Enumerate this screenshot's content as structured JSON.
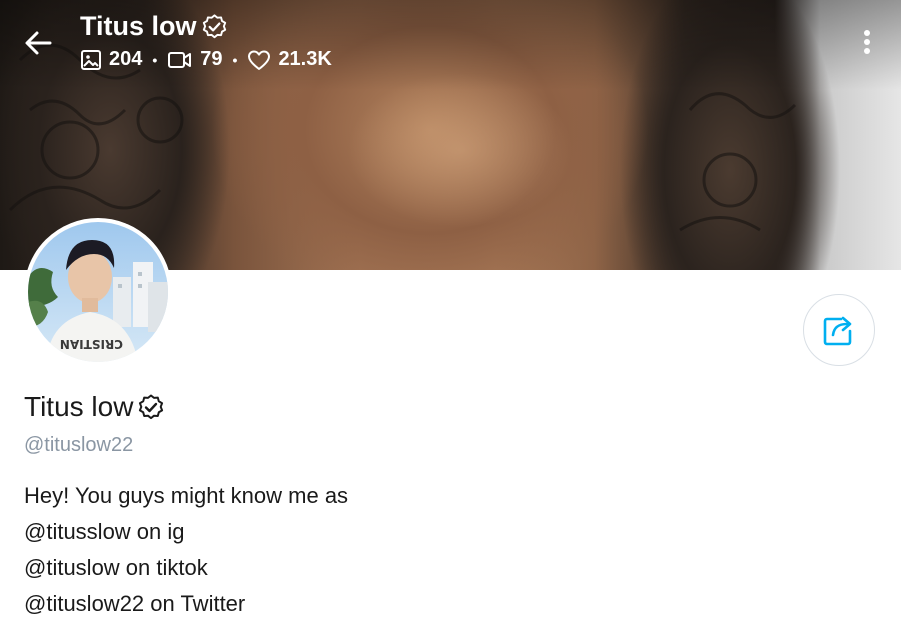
{
  "header": {
    "title": "Titus low",
    "stats": {
      "photos": "204",
      "videos": "79",
      "likes": "21.3K"
    },
    "separator": "•"
  },
  "profile": {
    "name": "Titus low",
    "handle": "@tituslow22",
    "bio": [
      "Hey! You guys might know me as",
      "@titusslow on ig",
      "@tituslow on tiktok",
      "@tituslow22 on Twitter"
    ],
    "avatar_shirt_text": "CRISTIAN"
  },
  "icons": {
    "back": "arrow-left-icon",
    "verified": "verified-badge-icon",
    "photos": "image-icon",
    "videos": "video-icon",
    "likes": "heart-icon",
    "more": "more-vertical-icon",
    "share": "share-icon"
  },
  "colors": {
    "accent": "#00aff0",
    "handle_gray": "#8a96a3",
    "text": "#1a1a1a"
  }
}
